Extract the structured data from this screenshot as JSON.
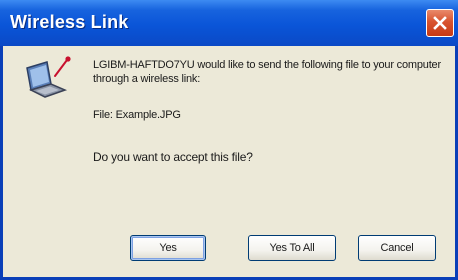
{
  "window": {
    "title": "Wireless Link"
  },
  "icons": {
    "close": "close-icon",
    "app": "laptop-wireless-icon"
  },
  "dialog": {
    "message": "LGIBM-HAFTDO7YU would like to send the following file to your computer through a wireless link:",
    "file_line": "File: Example.JPG",
    "question": "Do you want to accept this file?"
  },
  "buttons": {
    "yes": "Yes",
    "yes_to_all": "Yes To All",
    "cancel": "Cancel"
  },
  "colors": {
    "titlebar": "#0a55d8",
    "close_button": "#d8542f",
    "dialog_background": "#ece9d8",
    "button_border": "#003c74"
  }
}
